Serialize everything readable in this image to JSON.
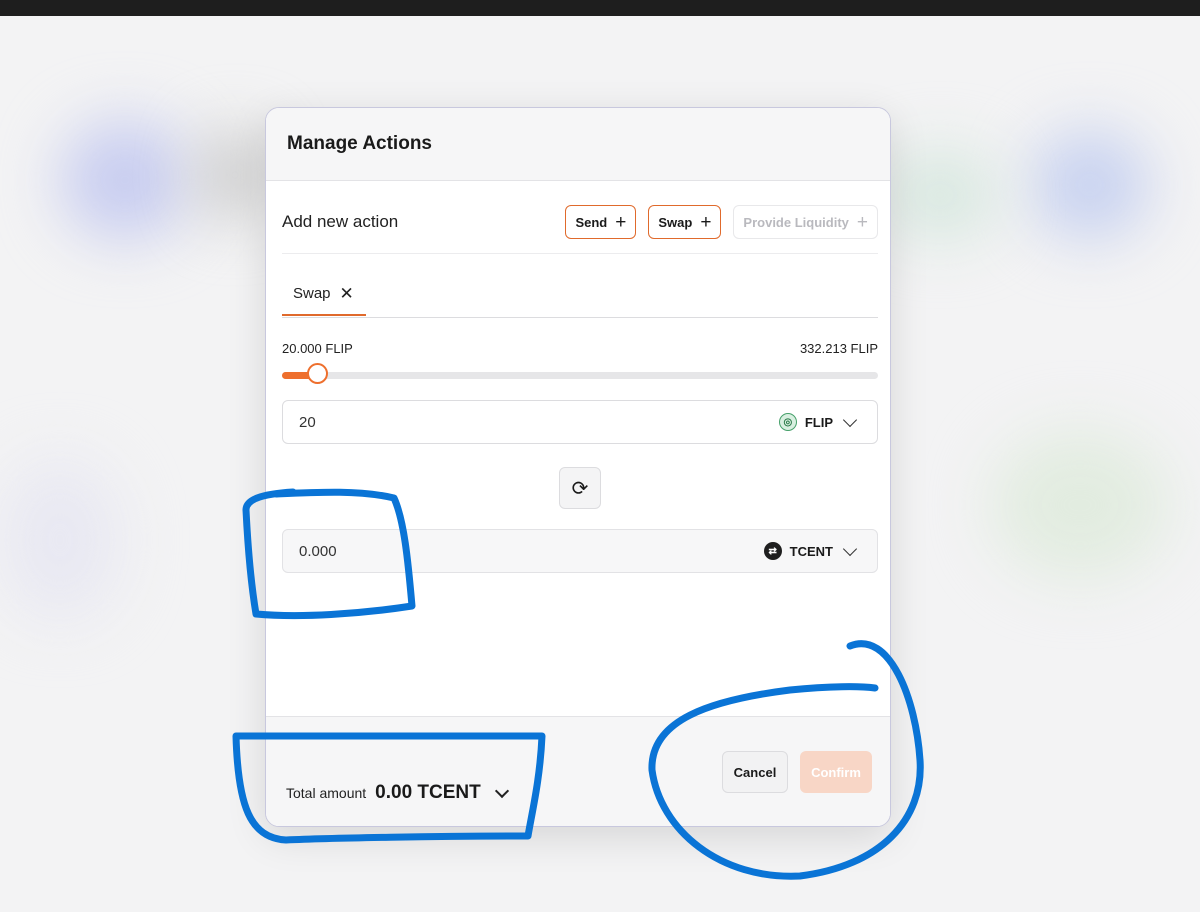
{
  "modal": {
    "title": "Manage Actions",
    "add_action_label": "Add new action",
    "action_buttons": [
      {
        "label": "Send",
        "icon": "plus-icon",
        "enabled": true
      },
      {
        "label": "Swap",
        "icon": "plus-icon",
        "enabled": true
      },
      {
        "label": "Provide Liquidity",
        "icon": "plus-icon",
        "enabled": false
      }
    ],
    "tabs": [
      {
        "label": "Swap",
        "close_icon": "close-icon"
      }
    ],
    "slider": {
      "min_label": "20.000 FLIP",
      "max_label": "332.213 FLIP",
      "position_fraction": 0.06
    },
    "from": {
      "value": "20",
      "token": "FLIP",
      "token_icon": "flip-token-icon"
    },
    "swap_icon": "swap-direction-icon",
    "to": {
      "value": "0.000",
      "token": "TCENT",
      "token_icon": "tcent-token-icon"
    },
    "footer": {
      "total_label": "Total amount",
      "total_value": "0.00 TCENT",
      "cancel_label": "Cancel",
      "confirm_label": "Confirm"
    }
  },
  "colors": {
    "accent": "#ee6f2d",
    "annotation": "#0a74d6",
    "confirm_disabled": "#f8d6c6"
  }
}
